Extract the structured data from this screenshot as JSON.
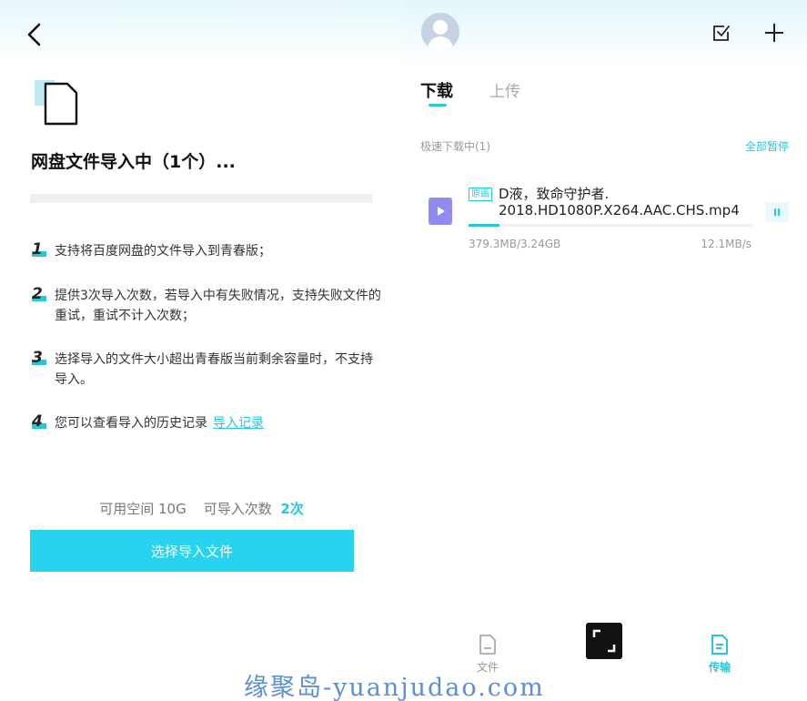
{
  "left": {
    "title": "网盘文件导入中（1个）...",
    "tips": [
      {
        "num": "1",
        "text": "支持将百度网盘的文件导入到青春版；"
      },
      {
        "num": "2",
        "text": "提供3次导入次数，若导入中有失败情况，支持失败文件的重试，重试不计入次数；"
      },
      {
        "num": "3",
        "text": "选择导入的文件大小超出青春版当前剩余容量时，不支持导入。"
      },
      {
        "num": "4",
        "text": "您可以查看导入的历史记录",
        "link": "导入记录"
      }
    ],
    "space_label": "可用空间 10G",
    "count_label": "可导入次数",
    "count_value": "2次",
    "select_button": "选择导入文件"
  },
  "right": {
    "tabs": [
      "下载",
      "上传"
    ],
    "active_tab": "下载",
    "section_label": "极速下载中(1)",
    "pause_all": "全部暂停",
    "task": {
      "badge": "原画",
      "name_line1": "D液，致命守护者.",
      "name_line2": "2018.HD1080P.X264.AAC.CHS.mp4",
      "size": "379.3MB/3.24GB",
      "speed": "12.1MB/s",
      "progress": 0.11
    },
    "nav": {
      "files": "文件",
      "transfer": "传输"
    }
  },
  "watermark": "缘聚岛-yuanjudao.com",
  "colors": {
    "accent": "#27c7d9",
    "button": "#27d3ee",
    "video_icon": "#8f8bf0"
  }
}
